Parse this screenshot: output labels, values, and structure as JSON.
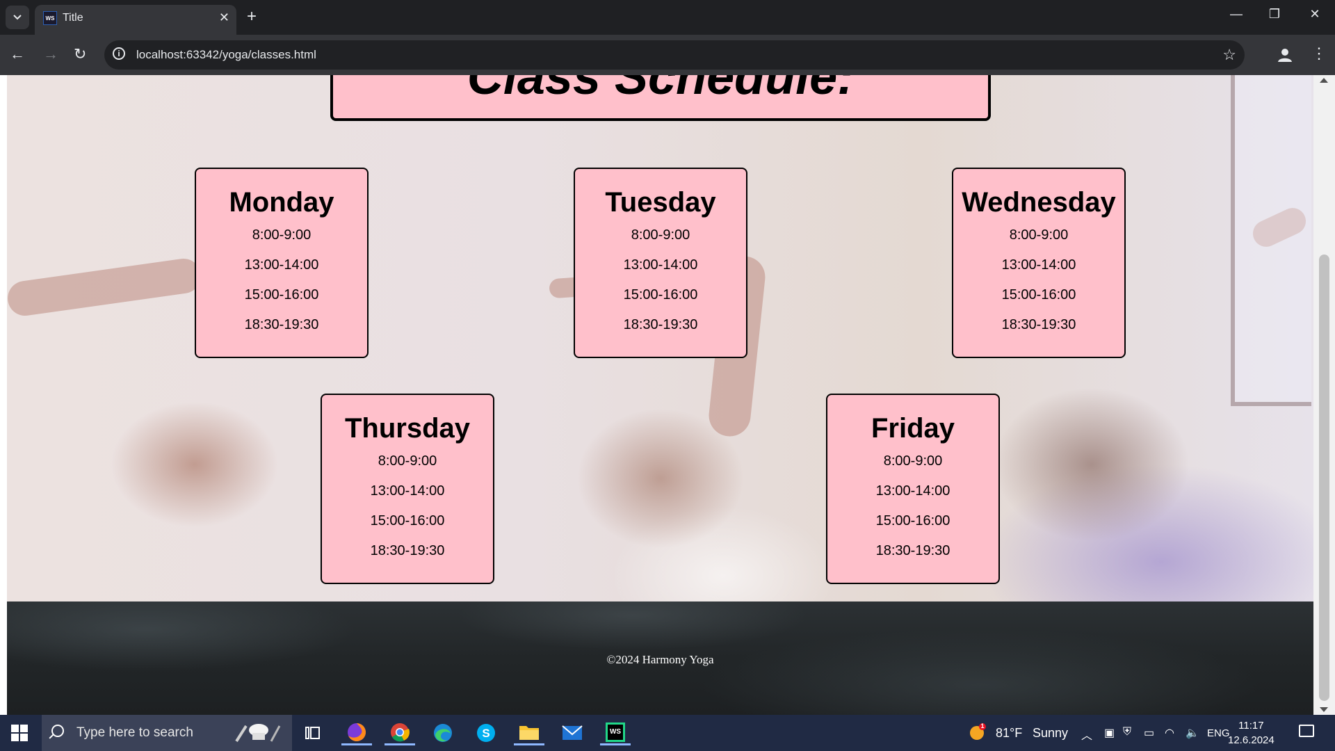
{
  "browser": {
    "tab_title": "Title",
    "tab_icon_text": "WS",
    "url": "localhost:63342/yoga/classes.html"
  },
  "page": {
    "heading": "Class Schedule:",
    "days": [
      {
        "name": "Monday",
        "slots": [
          "8:00-9:00",
          "13:00-14:00",
          "15:00-16:00",
          "18:30-19:30"
        ]
      },
      {
        "name": "Tuesday",
        "slots": [
          "8:00-9:00",
          "13:00-14:00",
          "15:00-16:00",
          "18:30-19:30"
        ]
      },
      {
        "name": "Wednesday",
        "slots": [
          "8:00-9:00",
          "13:00-14:00",
          "15:00-16:00",
          "18:30-19:30"
        ]
      },
      {
        "name": "Thursday",
        "slots": [
          "8:00-9:00",
          "13:00-14:00",
          "15:00-16:00",
          "18:30-19:30"
        ]
      },
      {
        "name": "Friday",
        "slots": [
          "8:00-9:00",
          "13:00-14:00",
          "15:00-16:00",
          "18:30-19:30"
        ]
      }
    ],
    "footer": "©2024 Harmony Yoga",
    "card_color": "#ffc0cb"
  },
  "taskbar": {
    "search_placeholder": "Type here to search",
    "weather_temp": "81°F",
    "weather_text": "Sunny",
    "weather_badge": "1",
    "language": "ENG",
    "time": "11:17",
    "date": "12.6.2024",
    "apps": [
      "firefox-icon",
      "chrome-icon",
      "edge-icon",
      "skype-icon",
      "file-explorer-icon",
      "mail-icon",
      "webstorm-icon"
    ]
  }
}
